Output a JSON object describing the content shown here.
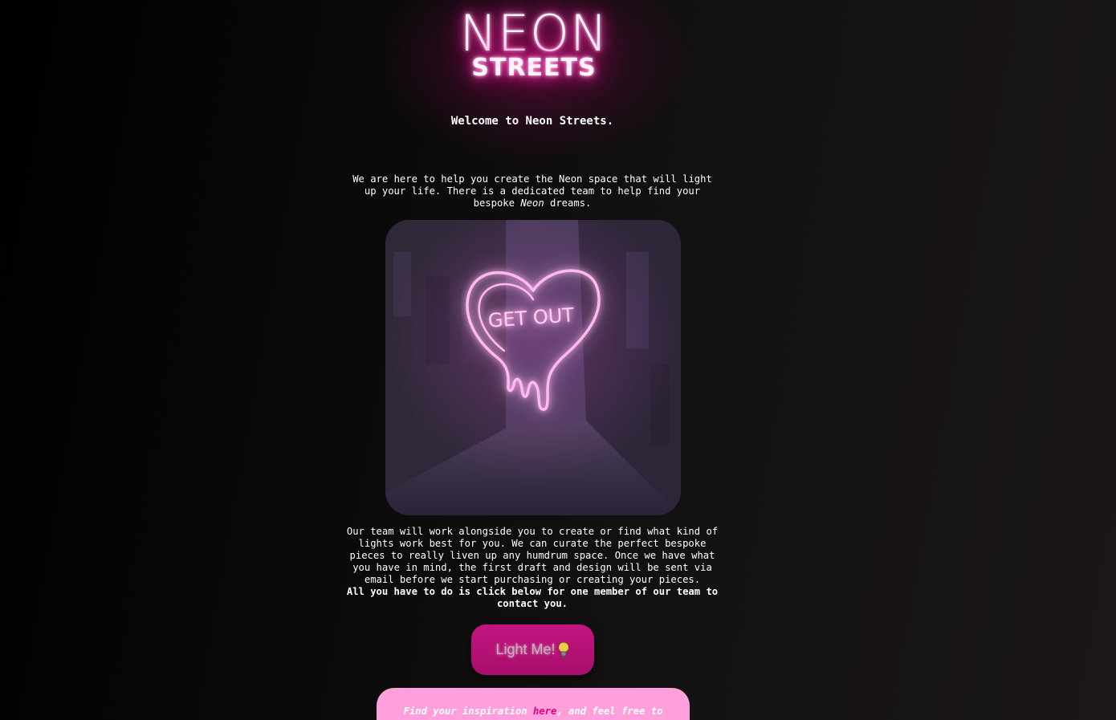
{
  "header": {
    "logo_line1": "NEON",
    "logo_line2": "STREETS",
    "welcome": "Welcome to Neon Streets."
  },
  "intro": {
    "text_before": "We are here to help you create the Neon space that will light up your life. There is a dedicated team to help find your bespoke ",
    "emphasis": "Neon",
    "text_after": " dreams."
  },
  "hero_image": {
    "sign_text": "GET OUT"
  },
  "description": {
    "paragraph": "Our team will work alongside you to create or find what kind of lights work best for you. We can curate the perfect bespoke pieces to really liven up any humdrum space. Once we have what you have in mind, the first draft and design will be sent via email before we start purchasing or creating your pieces.",
    "cta_text": "All you have to do is click below for one member of our team to contact you."
  },
  "cta_button": {
    "label": "Light Me!",
    "icon": "light-bulb-icon"
  },
  "info_box": {
    "text_before": "Find your inspiration ",
    "link_text": "here",
    "text_after": ", and feel free to"
  },
  "colors": {
    "neon_pink": "#ff2aa8",
    "button_magenta": "#c41481",
    "info_box_pink": "#ff9fdc",
    "link_magenta": "#e0007f"
  }
}
